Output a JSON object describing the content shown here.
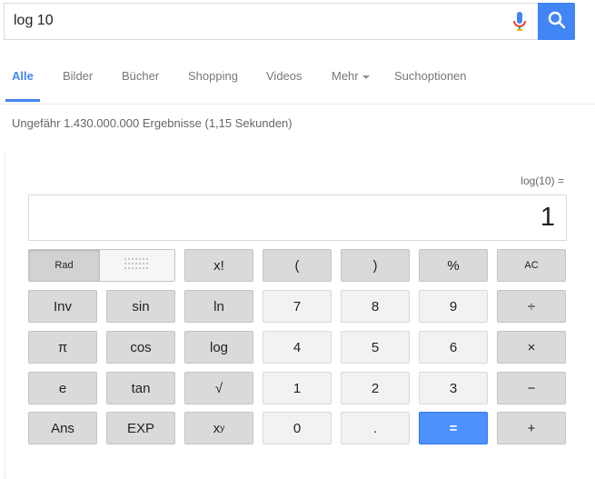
{
  "search": {
    "query": "log 10"
  },
  "tabs": [
    {
      "label": "Alle"
    },
    {
      "label": "Bilder"
    },
    {
      "label": "Bücher"
    },
    {
      "label": "Shopping"
    },
    {
      "label": "Videos"
    },
    {
      "label": "Mehr"
    },
    {
      "label": "Suchoptionen"
    }
  ],
  "results_stats": "Ungefähr 1.430.000.000 Ergebnisse (1,15 Sekunden)",
  "calculator": {
    "expression": "log(10) =",
    "result": "1",
    "rad_label": "Rad",
    "keys": {
      "fact": "x!",
      "lparen": "(",
      "rparen": ")",
      "percent": "%",
      "ac": "AC",
      "inv": "Inv",
      "sin": "sin",
      "ln": "ln",
      "seven": "7",
      "eight": "8",
      "nine": "9",
      "divide": "÷",
      "pi": "π",
      "cos": "cos",
      "log": "log",
      "four": "4",
      "five": "5",
      "six": "6",
      "multiply": "×",
      "e": "e",
      "tan": "tan",
      "sqrt": "√",
      "one": "1",
      "two": "2",
      "three": "3",
      "minus": "−",
      "ans": "Ans",
      "exp": "EXP",
      "zero": "0",
      "dot": ".",
      "equals": "=",
      "plus": "+"
    },
    "pow_base": "x",
    "pow_exp": "y"
  },
  "colors": {
    "accent": "#4285f4",
    "equals": "#4d90fe"
  }
}
